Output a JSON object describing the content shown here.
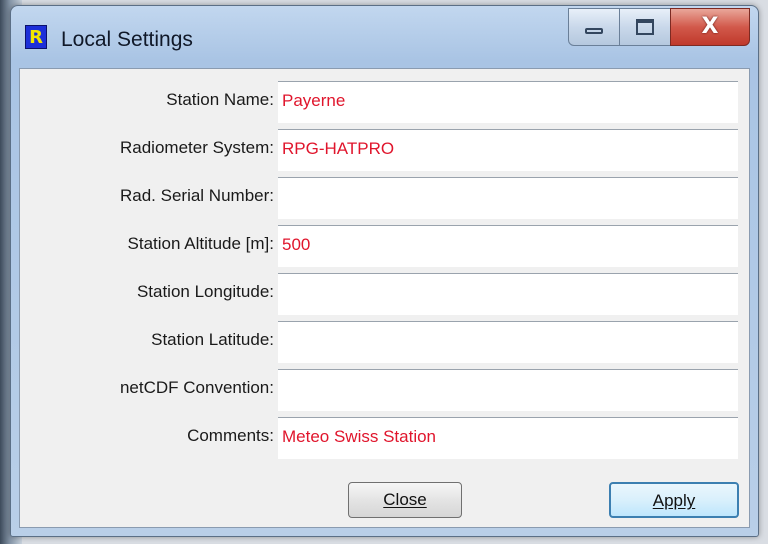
{
  "window": {
    "title": "Local Settings",
    "icon": "app-logo-icon",
    "icon_glyph": "R",
    "controls": {
      "minimize": "minimize-icon",
      "maximize": "maximize-icon",
      "close": "close-icon",
      "close_glyph": "X"
    }
  },
  "form": {
    "rows": [
      {
        "label": "Station Name:",
        "value": "Payerne"
      },
      {
        "label": "Radiometer System:",
        "value": "RPG-HATPRO"
      },
      {
        "label": "Rad. Serial Number:",
        "value": ""
      },
      {
        "label": "Station Altitude [m]:",
        "value": "500"
      },
      {
        "label": "Station Longitude:",
        "value": ""
      },
      {
        "label": "Station Latitude:",
        "value": ""
      },
      {
        "label": "netCDF Convention:",
        "value": ""
      },
      {
        "label": "Comments:",
        "value": "Meteo Swiss Station"
      }
    ]
  },
  "buttons": {
    "close_label": "Close",
    "apply_label": "Apply"
  },
  "colors": {
    "value_text": "#e0152c",
    "apply_border": "#3c7fb1",
    "close_red": "#c0392b"
  }
}
